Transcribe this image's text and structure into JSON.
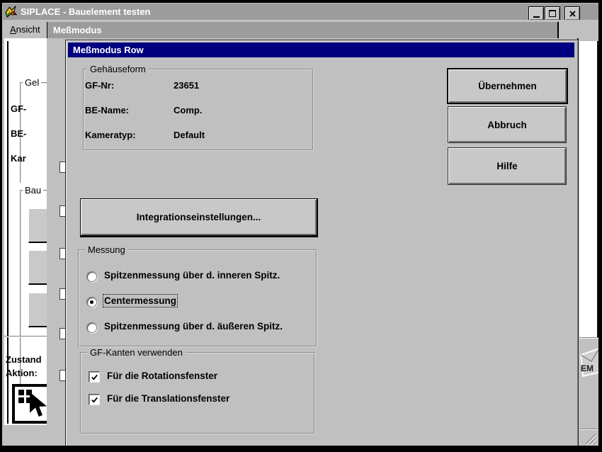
{
  "colors": {
    "active_titlebar": "#000080",
    "inactive_titlebar": "#9c9c9c",
    "surface": "#c0c0c0"
  },
  "main_window": {
    "title": "SIPLACE - Bauelement testen",
    "menu": {
      "ansicht": "Ansicht"
    },
    "icons": {
      "app_logo": "siplace-colored-logo",
      "minimize": "underscore-bar",
      "maximize": "square-outline",
      "close": "x-cross"
    }
  },
  "messmodus_window": {
    "title": "Meßmodus"
  },
  "dialog": {
    "title": "Meßmodus Row",
    "gehaeuseform": {
      "label": "Gehäuseform",
      "rows": [
        {
          "label": "GF-Nr:",
          "value": "23651"
        },
        {
          "label": "BE-Name:",
          "value": "Comp."
        },
        {
          "label": "Kameratyp:",
          "value": "Default"
        }
      ]
    },
    "buttons": {
      "uebernehmen": "Übernehmen",
      "abbruch": "Abbruch",
      "hilfe": "Hilfe",
      "integration": "Integrationseinstellungen..."
    },
    "messung": {
      "label": "Messung",
      "options": [
        {
          "label": "Spitzenmessung über d. inneren Spitz.",
          "selected": false
        },
        {
          "label": "Centermessung",
          "selected": true,
          "focused": true
        },
        {
          "label": "Spitzenmessung über d. äußeren Spitz.",
          "selected": false
        }
      ]
    },
    "gf_kanten": {
      "label": "GF-Kanten verwenden",
      "options": [
        {
          "label": "Für die Rotationsfenster",
          "checked": true
        },
        {
          "label": "Für die Translationsfenster",
          "checked": true
        }
      ]
    }
  },
  "background_window": {
    "partial_group_labels": {
      "gehaeuseform": "Gel",
      "bauelement": "Bau"
    },
    "partial_field_labels": {
      "gf": "GF-",
      "be": "BE-",
      "kamera": "Kar"
    },
    "status": {
      "zustand": "Zustand",
      "aktion": "Aktion:"
    },
    "logo_fragment": "EM"
  }
}
